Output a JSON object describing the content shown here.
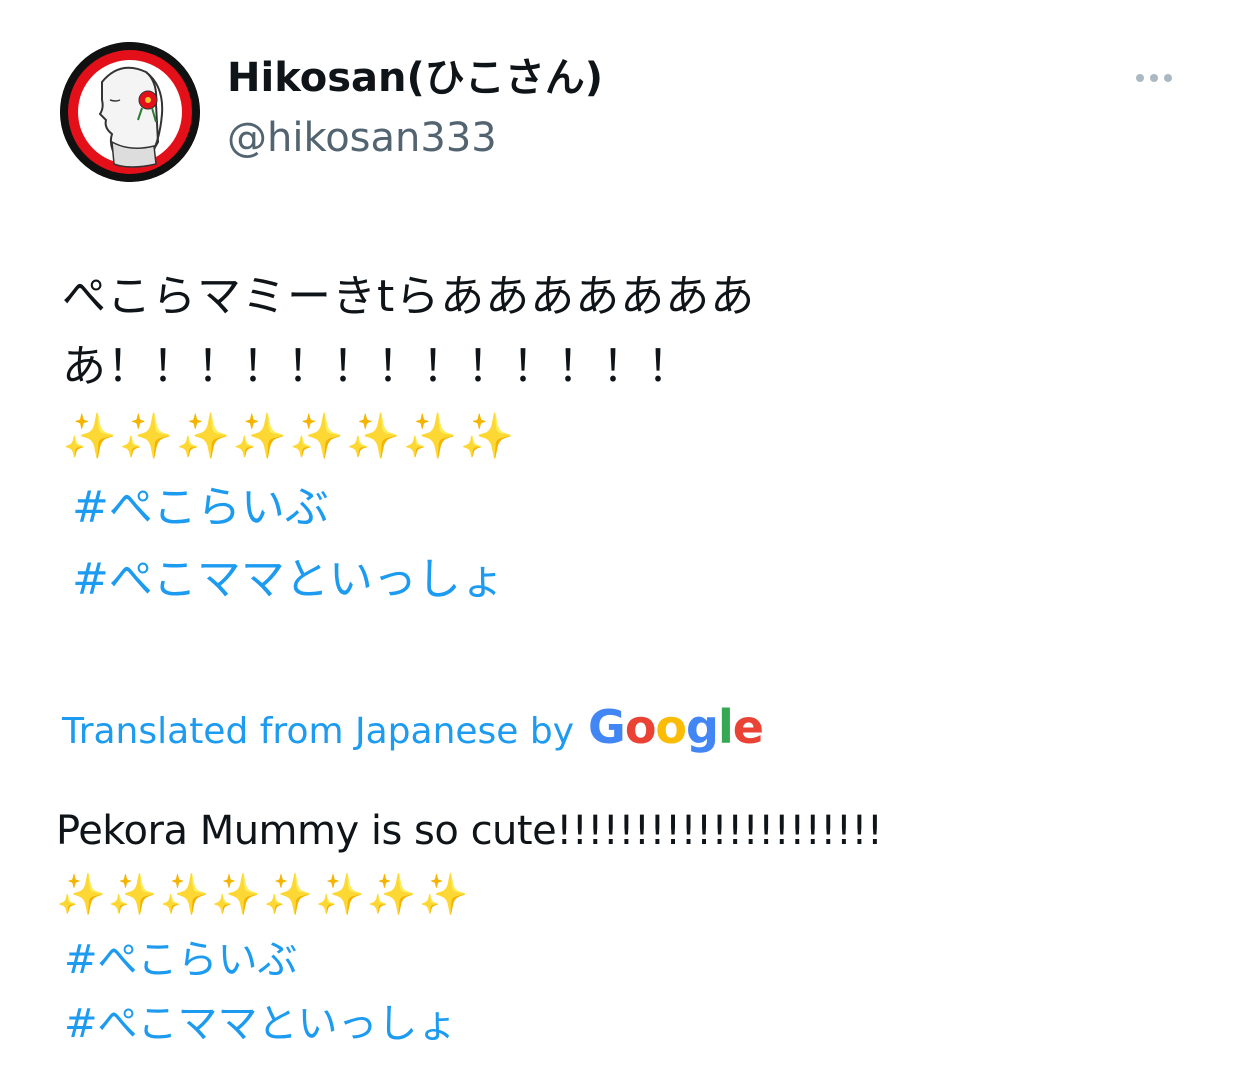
{
  "tweet": {
    "author": {
      "display_name": "Hikosan(ひこさん)",
      "handle": "@hikosan333",
      "avatar": "profile-avatar"
    },
    "more_icon": "more-horizontal-icon",
    "original": {
      "line1": "ぺこらマミーきtらあああああああ",
      "line2": "あ！！！！！！！！！！！！！",
      "sparkles": "✨✨✨✨✨✨✨✨",
      "hashtags": [
        "#ぺこらいぶ",
        "#ぺこママといっしょ"
      ]
    },
    "translation": {
      "label": "Translated from Japanese by",
      "provider": "Google",
      "text": "Pekora Mummy is so cute!!!!!!!!!!!!!!!!!!!!!",
      "sparkles": "✨✨✨✨✨✨✨✨",
      "hashtags": [
        "#ぺこらいぶ",
        "#ぺこママといっしょ"
      ]
    },
    "colors": {
      "link": "#1d9bf0",
      "text": "#0f1419",
      "secondary": "#536471",
      "avatar_ring": "#e3101a"
    }
  }
}
